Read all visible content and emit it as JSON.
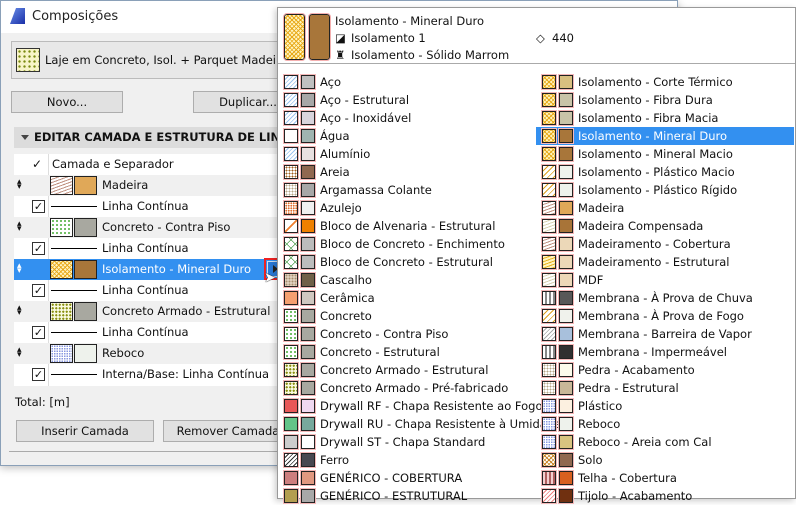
{
  "window": {
    "title": "Composições"
  },
  "composite": {
    "name": "Laje em Concreto, Isol. + Parquet Madeira"
  },
  "buttons": {
    "new": "Novo...",
    "duplicate": "Duplicar...",
    "insert": "Inserir Camada",
    "remove": "Remover Camada"
  },
  "section": {
    "title": "EDITAR CAMADA E ESTRUTURA DE LINHA"
  },
  "table": {
    "header": "Camada e Separador",
    "rows": [
      {
        "type": "layer",
        "label": "Madeira",
        "pattern": "wood",
        "color": "#e0a858"
      },
      {
        "type": "line",
        "label": "Linha Contínua"
      },
      {
        "type": "layer",
        "label": "Concreto - Contra Piso",
        "pattern": "conc-green",
        "color": "#a8a8a0"
      },
      {
        "type": "line",
        "label": "Linha Contínua"
      },
      {
        "type": "layer",
        "label": "Isolamento - Mineral Duro",
        "pattern": "insul",
        "color": "#a8763a",
        "selected": true
      },
      {
        "type": "line",
        "label": "Linha Contínua"
      },
      {
        "type": "layer",
        "label": "Concreto Armado - Estrutural",
        "pattern": "conc-olive",
        "color": "#a8a8a0"
      },
      {
        "type": "line",
        "label": "Linha Contínua"
      },
      {
        "type": "layer",
        "label": "Reboco",
        "pattern": "dots-blue",
        "color": "#eef2ec"
      },
      {
        "type": "line",
        "label": "Interna/Base: Linha Contínua"
      }
    ]
  },
  "total": "Total: [m]",
  "popup": {
    "header": {
      "title": "Isolamento - Mineral Duro",
      "fill": "Isolamento 1",
      "surface": "Isolamento - Sólido Marrom",
      "priority": "440",
      "pattern": "insul",
      "color": "#a8763a"
    },
    "columns": [
      [
        {
          "label": "Aço",
          "p": "diag-blue",
          "c": "#c0c0c0"
        },
        {
          "label": "Aço - Estrutural",
          "p": "diag-blue",
          "c": "#a8a8a8"
        },
        {
          "label": "Aço - Inoxidável",
          "p": "diag-blue",
          "c": "#d8d4dc"
        },
        {
          "label": "Água",
          "p": "none",
          "c": "#a0b4b0"
        },
        {
          "label": "Alumínio",
          "p": "diag-blue",
          "c": "#e8e0e0"
        },
        {
          "label": "Areia",
          "p": "dots-brown",
          "c": "#906850"
        },
        {
          "label": "Argamassa Colante",
          "p": "dots-tan",
          "c": "#a8a8a8"
        },
        {
          "label": "Azulejo",
          "p": "dots-orange",
          "c": "#f0f0f0"
        },
        {
          "label": "Bloco de Alvenaria - Estrutural",
          "p": "diag-orange",
          "c": "#f08000"
        },
        {
          "label": "Bloco de Concreto - Enchimento",
          "p": "cross-green",
          "c": "#bcbcbc"
        },
        {
          "label": "Bloco de Concreto - Estrutural",
          "p": "cross-green",
          "c": "#bcbcbc"
        },
        {
          "label": "Cascalho",
          "p": "gravel",
          "c": "#706048"
        },
        {
          "label": "Cerâmica",
          "p": "grid-orange",
          "c": "#d0c8c0"
        },
        {
          "label": "Concreto",
          "p": "conc-green",
          "c": "#a8a8a0"
        },
        {
          "label": "Concreto - Contra Piso",
          "p": "conc-green",
          "c": "#a8a8a0"
        },
        {
          "label": "Concreto - Estrutural",
          "p": "conc-green",
          "c": "#a8a8a0"
        },
        {
          "label": "Concreto Armado - Estrutural",
          "p": "conc-olive",
          "c": "#a8a8a0"
        },
        {
          "label": "Concreto Armado - Pré-fabricado",
          "p": "conc-olive",
          "c": "#a8a8a0"
        },
        {
          "label": "Drywall RF - Chapa Resistente ao Fogo",
          "p": "grid-red",
          "c": "#f0d8f0"
        },
        {
          "label": "Drywall RU - Chapa Resistente à Umidade",
          "p": "grid-green",
          "c": "#78a89c"
        },
        {
          "label": "Drywall ST - Chapa Standard",
          "p": "grid-gray",
          "c": "#ffffff"
        },
        {
          "label": "Ferro",
          "p": "diag-black",
          "c": "#484850"
        },
        {
          "label": "GENÉRICO - COBERTURA",
          "p": "grid-maroon",
          "c": "#e09880"
        },
        {
          "label": "GENÉRICO - ESTRUTURAL",
          "p": "grid-olive",
          "c": "#a8a8a8"
        }
      ],
      [
        {
          "label": "Isolamento - Corte Térmico",
          "p": "insul",
          "c": "#d8c080"
        },
        {
          "label": "Isolamento - Fibra Dura",
          "p": "insul",
          "c": "#c8c4a8"
        },
        {
          "label": "Isolamento - Fibra Macia",
          "p": "insul",
          "c": "#c8c4a8"
        },
        {
          "label": "Isolamento - Mineral Duro",
          "p": "insul",
          "c": "#a8763a",
          "selected": true
        },
        {
          "label": "Isolamento - Mineral Macio",
          "p": "insul",
          "c": "#a8763a"
        },
        {
          "label": "Isolamento - Plástico Macio",
          "p": "diag-yellow",
          "c": "#eef2ec"
        },
        {
          "label": "Isolamento - Plástico Rígido",
          "p": "diag-yellow",
          "c": "#eef2ec"
        },
        {
          "label": "Madeira",
          "p": "wood",
          "c": "#e0a858"
        },
        {
          "label": "Madeira Compensada",
          "p": "wood-light",
          "c": "#a87438"
        },
        {
          "label": "Madeiramento - Cobertura",
          "p": "wood",
          "c": "#ecd8b8"
        },
        {
          "label": "Madeiramento - Estrutural",
          "p": "wood-yellow",
          "c": "#ecd8b8"
        },
        {
          "label": "MDF",
          "p": "wood-light",
          "c": "#ecd8b8"
        },
        {
          "label": "Membrana - À Prova de Chuva",
          "p": "vstripes",
          "c": "#585858"
        },
        {
          "label": "Membrana - À Prova de Fogo",
          "p": "diag-yellow",
          "c": "#f0f2ec"
        },
        {
          "label": "Membrana - Barreira de Vapor",
          "p": "diag-gray",
          "c": "#a8c0dc"
        },
        {
          "label": "Membrana - Impermeável",
          "p": "vstripes",
          "c": "#303030"
        },
        {
          "label": "Pedra - Acabamento",
          "p": "dots-tan",
          "c": "#fcfcec"
        },
        {
          "label": "Pedra - Estrutural",
          "p": "dots-tan",
          "c": "#c8b898"
        },
        {
          "label": "Plástico",
          "p": "dots-blue",
          "c": "#fcf0e0"
        },
        {
          "label": "Reboco",
          "p": "dots-blue",
          "c": "#eef2ec"
        },
        {
          "label": "Reboco - Areia com Cal",
          "p": "dots-blue",
          "c": "#d8c480"
        },
        {
          "label": "Solo",
          "p": "check-orange",
          "c": "#906850"
        },
        {
          "label": "Telha - Cobertura",
          "p": "vstripes-red",
          "c": "#d86020"
        },
        {
          "label": "Tijolo - Acabamento",
          "p": "diag-red",
          "c": "#703010"
        }
      ]
    ]
  },
  "colors": {
    "accent": "#3390f0",
    "highlight": "#e22222"
  }
}
